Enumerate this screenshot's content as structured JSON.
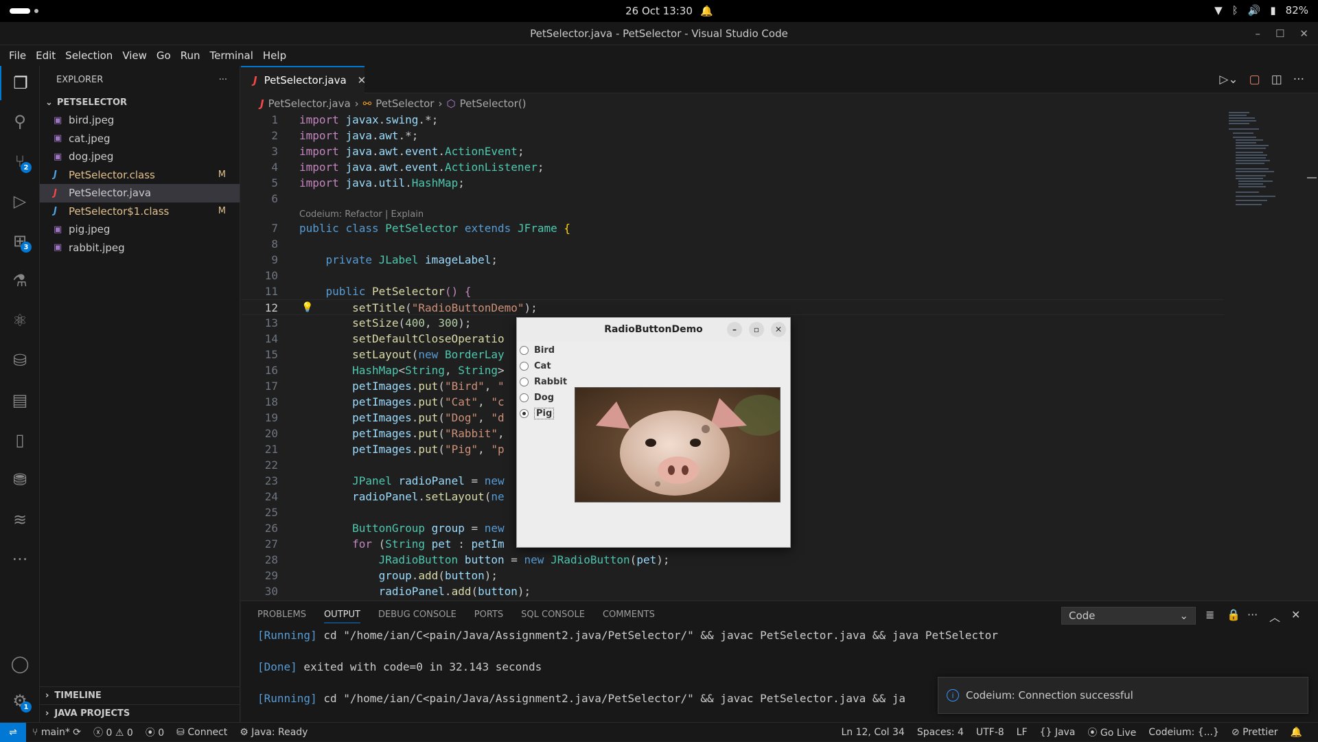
{
  "system": {
    "datetime": "26 Oct  13:30",
    "battery": "82%"
  },
  "window": {
    "title": "PetSelector.java - PetSelector - Visual Studio Code"
  },
  "menu": [
    "File",
    "Edit",
    "Selection",
    "View",
    "Go",
    "Run",
    "Terminal",
    "Help"
  ],
  "activity_badges": {
    "scm": "2",
    "extensions": "3",
    "settings": "1"
  },
  "sidebar": {
    "title": "EXPLORER",
    "folder": "PETSELECTOR",
    "files": [
      {
        "name": "bird.jpeg",
        "type": "image",
        "status": ""
      },
      {
        "name": "cat.jpeg",
        "type": "image",
        "status": ""
      },
      {
        "name": "dog.jpeg",
        "type": "image",
        "status": ""
      },
      {
        "name": "PetSelector.class",
        "type": "class",
        "status": "M"
      },
      {
        "name": "PetSelector.java",
        "type": "java",
        "status": ""
      },
      {
        "name": "PetSelector$1.class",
        "type": "class",
        "status": "M"
      },
      {
        "name": "pig.jpeg",
        "type": "image",
        "status": ""
      },
      {
        "name": "rabbit.jpeg",
        "type": "image",
        "status": ""
      }
    ],
    "timeline": "TIMELINE",
    "java_projects": "JAVA PROJECTS"
  },
  "tab": {
    "label": "PetSelector.java"
  },
  "breadcrumb": {
    "file": "PetSelector.java",
    "class": "PetSelector",
    "method": "PetSelector()"
  },
  "codelens": "Codeium: Refactor | Explain",
  "current_line": 12,
  "demo_window": {
    "title": "RadioButtonDemo",
    "options": [
      "Bird",
      "Cat",
      "Rabbit",
      "Dog",
      "Pig"
    ],
    "selected": "Pig"
  },
  "panel": {
    "tabs": [
      "PROBLEMS",
      "OUTPUT",
      "DEBUG CONSOLE",
      "PORTS",
      "SQL CONSOLE",
      "COMMENTS"
    ],
    "active_tab": "OUTPUT",
    "channel": "Code",
    "lines": [
      {
        "tag": "[Running]",
        "text": " cd \"/home/ian/C<pain/Java/Assignment2.java/PetSelector/\" && javac PetSelector.java && java PetSelector"
      },
      {
        "tag": "[Done]",
        "text": " exited with code=0 in 32.143 seconds"
      },
      {
        "tag": "[Running]",
        "text": " cd \"/home/ian/C<pain/Java/Assignment2.java/PetSelector/\" && javac PetSelector.java && ja"
      }
    ]
  },
  "toast": {
    "message": "Codeium: Connection successful"
  },
  "statusbar": {
    "branch": "main*",
    "errors": "0",
    "warnings": "0",
    "ports": "0",
    "connect": "Connect",
    "java": "Java: Ready",
    "position": "Ln 12, Col 34",
    "spaces": "Spaces: 4",
    "encoding": "UTF-8",
    "eol": "LF",
    "language": "Java",
    "golive": "Go Live",
    "codeium": "Codeium: {...}",
    "prettier": "Prettier"
  }
}
